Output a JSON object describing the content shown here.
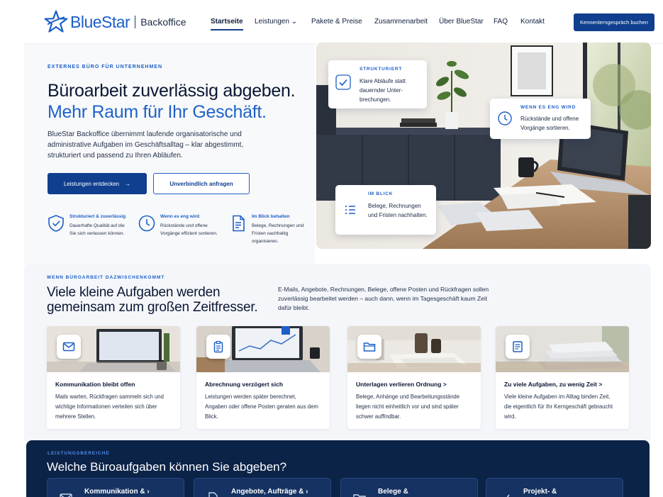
{
  "brand": {
    "name": "BlueStar",
    "sub": "Backoffice",
    "color": "#1b5fc9"
  },
  "nav": {
    "items": [
      {
        "label": "Startseite",
        "active": true
      },
      {
        "label": "Leistungen ⌄",
        "active": false
      },
      {
        "label": "Pakete & Preise",
        "active": false
      },
      {
        "label": "Zusammenarbeit",
        "active": false
      },
      {
        "label": "Über BlueStar",
        "active": false
      },
      {
        "label": "FAQ",
        "active": false
      },
      {
        "label": "Kontakt",
        "active": false
      }
    ],
    "cta": "Kennenlerngespräch buchen"
  },
  "hero": {
    "eyebrow": "EXTERNES BÜRO FÜR UNTERNEHMEN",
    "title_line1": "Büroarbeit zuverlässig abgeben.",
    "title_line2": "Mehr Raum für Ihr Geschäft.",
    "lead": "BlueStar Backoffice übernimmt laufende organisatorische und administrative Aufgaben im Geschäftsalltag – klar abgestimmt, strukturiert und passend zu Ihren Abläufen.",
    "btn_primary": "Leistungen entdecken",
    "btn_primary_arrow": "→",
    "btn_secondary": "Unverbindlich anfragen",
    "features": [
      {
        "icon": "shield-check-icon",
        "title": "Strukturiert & zuverlässig",
        "text": "Dauerhafte Qualität auf die Sie sich verlassen können."
      },
      {
        "icon": "clock-icon",
        "title": "Wenn es eng wird",
        "text": "Rückstände und offene Vorgänge effizient sortieren."
      },
      {
        "icon": "document-icon",
        "title": "Im Blick behalten",
        "text": "Belege, Rechnungen und Fristen nachhaltig organisieren."
      }
    ]
  },
  "hero_cards": [
    {
      "label": "STRUKTURIERT",
      "text": "Klare Abläufe statt dauernder Unter-brechungen.",
      "icon": "check-icon"
    },
    {
      "label": "WENN ES ENG WIRD",
      "text": "Rückstände und offene Vorgänge sortieren.",
      "icon": "clock-icon"
    },
    {
      "label": "IM BLICK",
      "text": "Belege, Rechnungen und Fristen nachhalten.",
      "icon": "list-icon"
    }
  ],
  "problems": {
    "eyebrow": "WENN BÜROARBEIT DAZWISCHENKOMMT",
    "title_line1": "Viele kleine Aufgaben werden",
    "title_line2": "gemeinsam zum großen Zeitfresser.",
    "text": "E-Mails, Angebote, Rechnungen, Belege, offene Posten und Rückfragen sollen zuverlässig bearbeitet werden – auch dann, wenn im Tagesgeschäft kaum Zeit dafür bleibt.",
    "cards": [
      {
        "icon": "mail-icon",
        "title": "Kommunikation bleibt offen",
        "text": "Mails warten, Rückfragen sammeln sich und wichtige Informationen verteilen sich über mehrere Stellen."
      },
      {
        "icon": "clipboard-icon",
        "title": "Abrechnung verzögert sich",
        "text": "Leistungen werden später berechnet, Angaben oder offene Posten geraten aus dem Blick."
      },
      {
        "icon": "folder-icon",
        "title": "Unterlagen verlieren Ordnung  >",
        "text": "Belege, Anhänge und Bearbeitungsstände liegen nicht einheitlich vor und sind später schwer auffindbar."
      },
      {
        "icon": "stack-icon",
        "title": "Zu viele Aufgaben, zu wenig Zeit  >",
        "text": "Viele kleine Aufgaben im Alltag binden Zeit, die eigentlich für Ihr Kerngeschäft gebraucht wird."
      }
    ]
  },
  "services": {
    "eyebrow": "LEISTUNGSBEREICHE",
    "title": "Welche Büroaufgaben können Sie abgeben?",
    "items": [
      {
        "icon": "mail-icon",
        "label": "Kommunikation &  ›"
      },
      {
        "icon": "document-icon",
        "label": "Angebote, Aufträge &  ›"
      },
      {
        "icon": "folder-icon",
        "label": "Belege &"
      },
      {
        "icon": "check-icon",
        "label": "Projekt- &"
      }
    ]
  }
}
